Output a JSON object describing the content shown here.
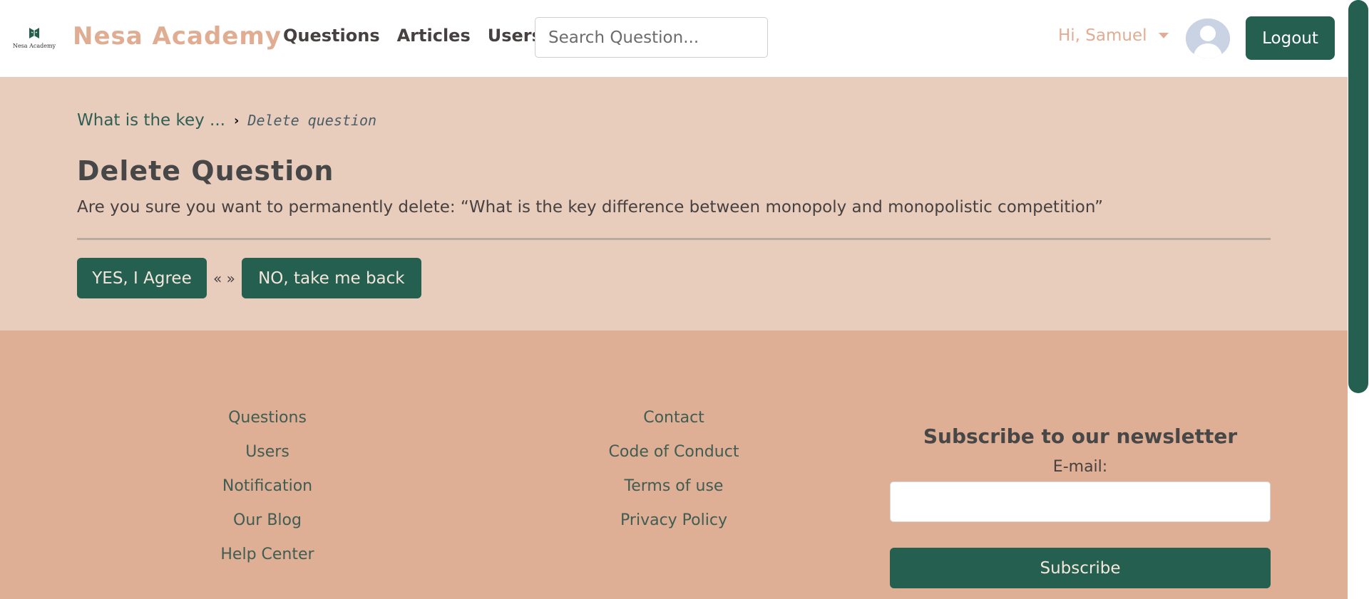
{
  "header": {
    "logo_icon": "academy-book-logo-icon",
    "logo_caption": "Nesa Academy",
    "brand_name": "Nesa Academy",
    "nav": [
      {
        "label": "Questions"
      },
      {
        "label": "Articles"
      },
      {
        "label": "Users"
      }
    ],
    "search": {
      "placeholder": "Search Question...",
      "value": ""
    },
    "user_greeting": "Hi, Samuel",
    "user_caret_icon": "caret-down-icon",
    "avatar_icon": "user-avatar-icon",
    "logout_label": "Logout"
  },
  "main": {
    "breadcrumb": {
      "parent": "What is the key ...",
      "separator_icon": "chevron-right-icon",
      "separator": "›",
      "current": "Delete question"
    },
    "title": "Delete Question",
    "confirm_text": "Are you sure you want to permanently delete: “What is the key difference between monopoly and monopolistic competition”",
    "yes_label": "YES, I Agree",
    "quote_separator": "« »",
    "no_label": "NO, take me back"
  },
  "footer": {
    "col1": [
      {
        "label": "Questions"
      },
      {
        "label": "Users"
      },
      {
        "label": "Notification"
      },
      {
        "label": "Our Blog"
      },
      {
        "label": "Help Center"
      }
    ],
    "col2": [
      {
        "label": "Contact"
      },
      {
        "label": "Code of Conduct"
      },
      {
        "label": "Terms of use"
      },
      {
        "label": "Privacy Policy"
      }
    ],
    "newsletter": {
      "title": "Subscribe to our newsletter",
      "email_label": "E-mail:",
      "email_value": "",
      "subscribe_label": "Subscribe"
    }
  },
  "colors": {
    "primary_green": "#245f4f",
    "brand_peach": "#e1ad92",
    "main_bg": "#e8cdbd",
    "footer_bg": "#deae95"
  }
}
